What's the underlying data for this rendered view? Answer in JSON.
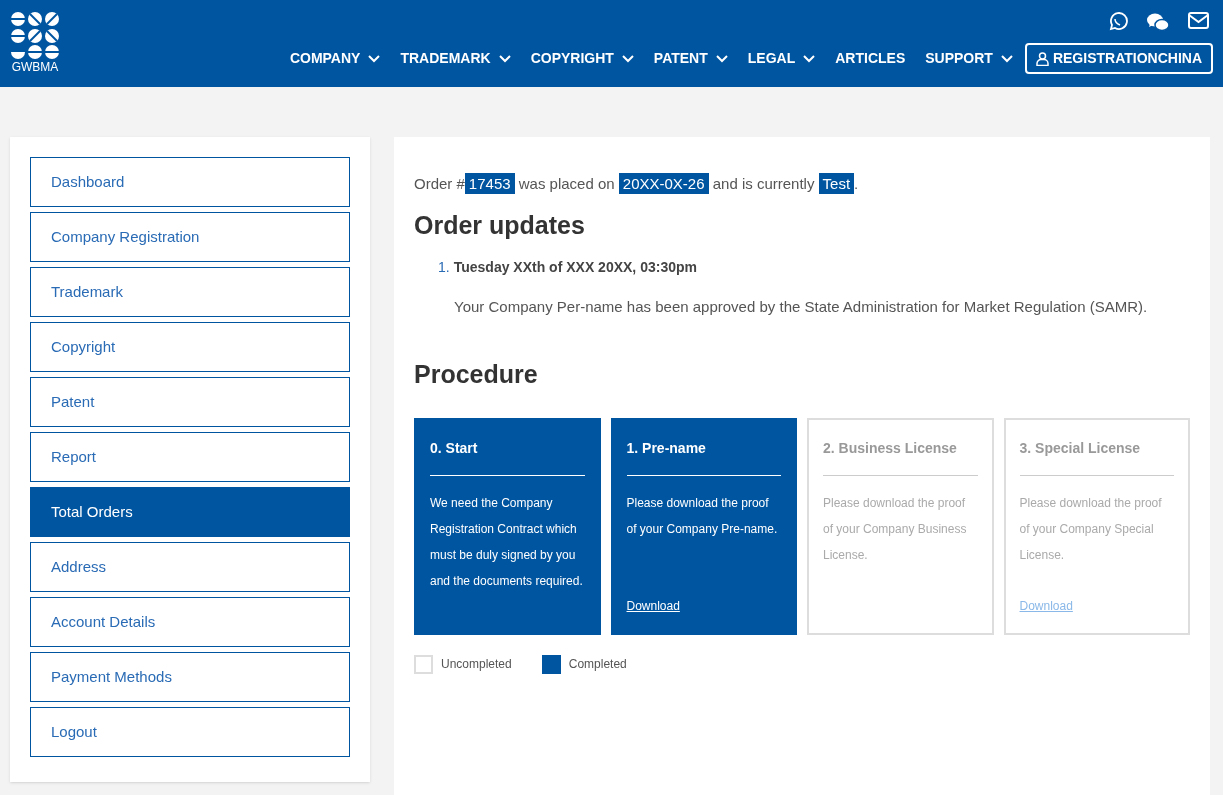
{
  "header": {
    "logo_text": "GWBMA",
    "nav": [
      {
        "label": "COMPANY",
        "dropdown": true
      },
      {
        "label": "TRADEMARK",
        "dropdown": true
      },
      {
        "label": "COPYRIGHT",
        "dropdown": true
      },
      {
        "label": "PATENT",
        "dropdown": true
      },
      {
        "label": "LEGAL",
        "dropdown": true
      },
      {
        "label": "ARTICLES",
        "dropdown": false
      },
      {
        "label": "SUPPORT",
        "dropdown": true
      }
    ],
    "account_button": "REGISTRATIONCHINA"
  },
  "sidebar": {
    "items": [
      {
        "label": "Dashboard",
        "selected": false
      },
      {
        "label": "Company Registration",
        "selected": false
      },
      {
        "label": "Trademark",
        "selected": false
      },
      {
        "label": "Copyright",
        "selected": false
      },
      {
        "label": "Patent",
        "selected": false
      },
      {
        "label": "Report",
        "selected": false
      },
      {
        "label": "Total Orders",
        "selected": true
      },
      {
        "label": "Address",
        "selected": false
      },
      {
        "label": "Account Details",
        "selected": false
      },
      {
        "label": "Payment Methods",
        "selected": false
      },
      {
        "label": "Logout",
        "selected": false
      }
    ]
  },
  "order_summary": [
    {
      "kind": "text",
      "text": "Order #"
    },
    {
      "kind": "tag",
      "text": "17453"
    },
    {
      "kind": "text",
      "text": " was placed on "
    },
    {
      "kind": "tag",
      "text": "20XX-0X-26"
    },
    {
      "kind": "text",
      "text": " and is currently "
    },
    {
      "kind": "tag",
      "text": "Test"
    },
    {
      "kind": "text",
      "text": "."
    }
  ],
  "updates": {
    "title": "Order updates",
    "items": [
      {
        "number": "1.",
        "date": "Tuesday XXth of XXX 20XX, 03:30pm",
        "message": "Your Company Per-name has been approved by the State Administration for Market Regulation (SAMR)."
      }
    ]
  },
  "procedure": {
    "title": "Procedure",
    "steps": [
      {
        "title": "0. Start",
        "text": "We need the Company Registration Contract which must be duly signed by you and the documents required.",
        "completed": true
      },
      {
        "title": "1. Pre-name",
        "text": "Please download the proof of your Company Pre-name.",
        "completed": true,
        "link": "Download"
      },
      {
        "title": "2. Business License",
        "text": "Please download the proof of your Company Business License.",
        "completed": false
      },
      {
        "title": "3. Special License",
        "text": "Please download the proof of your Company Special License.",
        "completed": false,
        "link": "Download"
      }
    ],
    "legend": [
      {
        "label": "Uncompleted",
        "completed": false
      },
      {
        "label": "Completed",
        "completed": true
      }
    ]
  }
}
